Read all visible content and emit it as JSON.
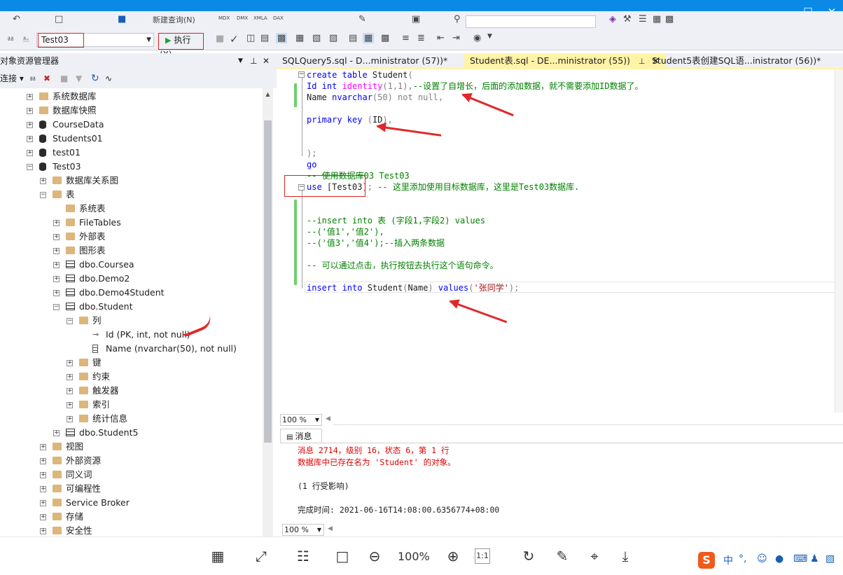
{
  "toolbar": {
    "new_query": "新建查询(N)",
    "db_selected": "Test03",
    "execute_label": "执行(X)",
    "zoom_mini_labels": [
      "MDX",
      "DMX",
      "XMLA",
      "DAX"
    ]
  },
  "object_explorer": {
    "title": "对象资源管理器",
    "connect_label": "连接",
    "tree": [
      {
        "label": "系统数据库",
        "type": "folder",
        "level": 0,
        "expander": "+"
      },
      {
        "label": "数据库快照",
        "type": "folder",
        "level": 0,
        "expander": "+"
      },
      {
        "label": "CourseData",
        "type": "db",
        "level": 0,
        "expander": "+"
      },
      {
        "label": "Students01",
        "type": "db",
        "level": 0,
        "expander": "+"
      },
      {
        "label": "test01",
        "type": "db",
        "level": 0,
        "expander": "+"
      },
      {
        "label": "Test03",
        "type": "db",
        "level": 0,
        "expander": "-"
      },
      {
        "label": "数据库关系图",
        "type": "folder",
        "level": 1,
        "expander": "+"
      },
      {
        "label": "表",
        "type": "folder",
        "level": 1,
        "expander": "-"
      },
      {
        "label": "系统表",
        "type": "folder",
        "level": 2,
        "expander": ""
      },
      {
        "label": "FileTables",
        "type": "folder",
        "level": 2,
        "expander": "+"
      },
      {
        "label": "外部表",
        "type": "folder",
        "level": 2,
        "expander": "+"
      },
      {
        "label": "图形表",
        "type": "folder",
        "level": 2,
        "expander": "+"
      },
      {
        "label": "dbo.Coursea",
        "type": "table",
        "level": 2,
        "expander": "+"
      },
      {
        "label": "dbo.Demo2",
        "type": "table",
        "level": 2,
        "expander": "+"
      },
      {
        "label": "dbo.Demo4Student",
        "type": "table",
        "level": 2,
        "expander": "+"
      },
      {
        "label": "dbo.Student",
        "type": "table",
        "level": 2,
        "expander": "-"
      },
      {
        "label": "列",
        "type": "folder",
        "level": 3,
        "expander": "-"
      },
      {
        "label": "Id (PK, int, not null)",
        "type": "key",
        "level": 4,
        "expander": ""
      },
      {
        "label": "Name (nvarchar(50), not null)",
        "type": "column",
        "level": 4,
        "expander": ""
      },
      {
        "label": "键",
        "type": "folder",
        "level": 3,
        "expander": "+"
      },
      {
        "label": "约束",
        "type": "folder",
        "level": 3,
        "expander": "+"
      },
      {
        "label": "触发器",
        "type": "folder",
        "level": 3,
        "expander": "+"
      },
      {
        "label": "索引",
        "type": "folder",
        "level": 3,
        "expander": "+"
      },
      {
        "label": "统计信息",
        "type": "folder",
        "level": 3,
        "expander": "+"
      },
      {
        "label": "dbo.Student5",
        "type": "table",
        "level": 2,
        "expander": "+"
      },
      {
        "label": "视图",
        "type": "folder",
        "level": 1,
        "expander": "+"
      },
      {
        "label": "外部资源",
        "type": "folder",
        "level": 1,
        "expander": "+"
      },
      {
        "label": "同义词",
        "type": "folder",
        "level": 1,
        "expander": "+"
      },
      {
        "label": "可编程性",
        "type": "folder",
        "level": 1,
        "expander": "+"
      },
      {
        "label": "Service Broker",
        "type": "folder",
        "level": 1,
        "expander": "+"
      },
      {
        "label": "存储",
        "type": "folder",
        "level": 1,
        "expander": "+"
      },
      {
        "label": "安全性",
        "type": "folder",
        "level": 1,
        "expander": "+"
      }
    ]
  },
  "tabs": [
    {
      "label": "SQLQuery5.sql - D...ministrator (57))*",
      "active": false
    },
    {
      "label": "Student表.sql - DE...ministrator (55))",
      "active": true
    },
    {
      "label": "Student5表创建SQL语...inistrator (56))*",
      "active": false
    }
  ],
  "editor_lines": [
    [
      [
        "kw",
        "create table "
      ],
      [
        "",
        "Student"
      ],
      [
        "gr",
        "("
      ]
    ],
    [
      [
        "kw",
        "Id int "
      ],
      [
        "fn",
        "identity"
      ],
      [
        "gr",
        "(1,1),"
      ],
      [
        "cm",
        "--设置了自增长，后面的添加数据，就不需要添加ID数据了。"
      ]
    ],
    [
      [
        "",
        "Name "
      ],
      [
        "kw",
        "nvarchar"
      ],
      [
        "gr",
        "(50) not null,"
      ]
    ],
    [],
    [
      [
        "kw",
        "primary key "
      ],
      [
        "gr",
        "("
      ],
      [
        "",
        "ID"
      ],
      [
        "gr",
        "),"
      ]
    ],
    [],
    [],
    [
      [
        "gr",
        ");"
      ]
    ],
    [
      [
        "kw",
        "go"
      ]
    ],
    [
      [
        "cm",
        "-- 使用数据库03 Test03"
      ]
    ],
    [
      [
        "kw",
        "use "
      ],
      [
        "",
        "[Test03]"
      ],
      [
        "gr",
        "; "
      ],
      [
        "cm",
        "-- 这里添加使用目标数据库，这里是Test03数据库."
      ]
    ],
    [],
    [],
    [
      [
        "cm",
        "--insert into 表 (字段1,字段2) values"
      ]
    ],
    [
      [
        "cm",
        "--('值1','值2'),"
      ]
    ],
    [
      [
        "cm",
        "--('值3','值4');--插入两条数据"
      ]
    ],
    [],
    [
      [
        "cm",
        "-- 可以通过点击，执行按钮去执行这个语句命令。"
      ]
    ],
    [],
    [
      [
        "kw",
        "insert into "
      ],
      [
        "",
        "Student"
      ],
      [
        "gr",
        "("
      ],
      [
        "",
        "Name"
      ],
      [
        "gr",
        ") "
      ],
      [
        "kw",
        "values"
      ],
      [
        "gr",
        "("
      ],
      [
        "st",
        "'张同学'"
      ],
      [
        "gr",
        ");"
      ]
    ]
  ],
  "zoom_editor": "100 %",
  "messages": {
    "tab_label": "消息",
    "lines": [
      {
        "text": "消息 2714，级别 16，状态 6，第 1 行",
        "color": "#e00000"
      },
      {
        "text": "数据库中已存在名为 'Student' 的对象。",
        "color": "#e00000"
      },
      {
        "text": "",
        "color": "#1e1e1e"
      },
      {
        "text": "(1 行受影响)",
        "color": "#1e1e1e"
      },
      {
        "text": "",
        "color": "#1e1e1e"
      },
      {
        "text": "完成时间: 2021-06-16T14:08:00.6356774+08:00",
        "color": "#1e1e1e"
      }
    ]
  },
  "zoom_messages": "100 %",
  "viewer": {
    "zoom_text": "100%"
  },
  "ime": {
    "logo": "S",
    "mode": "中"
  },
  "colors": {
    "titlebar": "#0a8ae6",
    "accent_tab": "#fff3a8",
    "annotation": "#e0282a"
  }
}
